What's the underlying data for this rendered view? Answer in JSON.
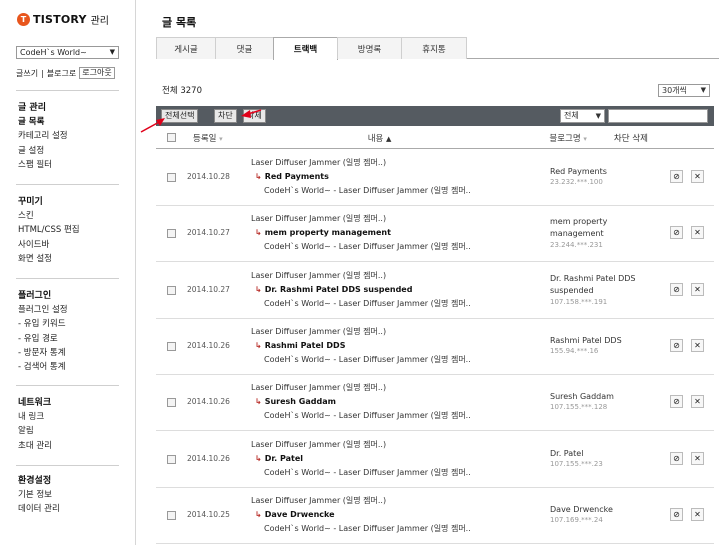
{
  "sidebar": {
    "logo": {
      "brand": "TISTORY",
      "suffix": "관리",
      "mark": "T"
    },
    "blog_select": "CodeH`s World~",
    "links": [
      "글쓰기",
      "블로그로",
      "로그아웃"
    ],
    "groups": [
      {
        "title": "글 관리",
        "items": [
          "글 목록",
          "카테고리 설정",
          "글 설정",
          "스팸 필터"
        ]
      },
      {
        "title": "꾸미기",
        "items": [
          "스킨",
          "HTML/CSS 편집",
          "사이드바",
          "화면 설정"
        ]
      },
      {
        "title": "플러그인",
        "items": [
          "플러그인 설정",
          "- 유입 키워드",
          "- 유입 경로",
          "- 방문자 통계",
          "- 검색어 통계"
        ]
      },
      {
        "title": "네트워크",
        "items": [
          "내 링크",
          "알림",
          "초대 관리"
        ]
      },
      {
        "title": "환경설정",
        "items": [
          "기본 정보",
          "데이터 관리"
        ]
      }
    ]
  },
  "main": {
    "title": "글 목록",
    "tabs": [
      "게시글",
      "댓글",
      "트랙백",
      "방명록",
      "휴지통"
    ],
    "active_tab": "트랙백",
    "total_label": "전체",
    "total_count": "3270",
    "per_page": "30개씩",
    "toolbar": {
      "select_all": "전체선택",
      "block": "차단",
      "delete": "삭제",
      "filter": "전체"
    },
    "columns": {
      "date": "등록일",
      "content": "내용",
      "blog": "블로그명",
      "actions": "차단 삭제"
    },
    "rows": [
      {
        "date": "2014.10.28",
        "post": "Laser Diffuser Jammer (일명 젬머..)",
        "title": "Red Payments",
        "sub": "CodeH`s World~ - Laser Diffuser Jammer (일명 젬머..",
        "blog": "Red Payments",
        "ip": "23.232.***.100"
      },
      {
        "date": "2014.10.27",
        "post": "Laser Diffuser Jammer (일명 젬머..)",
        "title": "mem property management",
        "sub": "CodeH`s World~ - Laser Diffuser Jammer (일명 젬머..",
        "blog": "mem property management",
        "ip": "23.244.***.231"
      },
      {
        "date": "2014.10.27",
        "post": "Laser Diffuser Jammer (일명 젬머..)",
        "title": "Dr. Rashmi Patel DDS suspended",
        "sub": "CodeH`s World~ - Laser Diffuser Jammer (일명 젬머..",
        "blog": "Dr. Rashmi Patel DDS suspended",
        "ip": "107.158.***.191"
      },
      {
        "date": "2014.10.26",
        "post": "Laser Diffuser Jammer (일명 젬머..)",
        "title": "Rashmi Patel DDS",
        "sub": "CodeH`s World~ - Laser Diffuser Jammer (일명 젬머..",
        "blog": "Rashmi Patel DDS",
        "ip": "155.94.***.16"
      },
      {
        "date": "2014.10.26",
        "post": "Laser Diffuser Jammer (일명 젬머..)",
        "title": "Suresh Gaddam",
        "sub": "CodeH`s World~ - Laser Diffuser Jammer (일명 젬머..",
        "blog": "Suresh Gaddam",
        "ip": "107.155.***.128"
      },
      {
        "date": "2014.10.26",
        "post": "Laser Diffuser Jammer (일명 젬머..)",
        "title": "Dr. Patel",
        "sub": "CodeH`s World~ - Laser Diffuser Jammer (일명 젬머..",
        "blog": "Dr. Patel",
        "ip": "107.155.***.23"
      },
      {
        "date": "2014.10.25",
        "post": "Laser Diffuser Jammer (일명 젬머..)",
        "title": "Dave Drwencke",
        "sub": "CodeH`s World~ - Laser Diffuser Jammer (일명 젬머..",
        "blog": "Dave Drwencke",
        "ip": "107.169.***.24"
      }
    ]
  },
  "icons": {
    "block": "block-icon",
    "delete": "close-icon",
    "trackback_arrow": "trackback-arrow-icon"
  },
  "colors": {
    "logo": "#e8561d",
    "toolbar": "#555b61",
    "arrow": "#b9302b",
    "annotation": "#e0001a"
  }
}
